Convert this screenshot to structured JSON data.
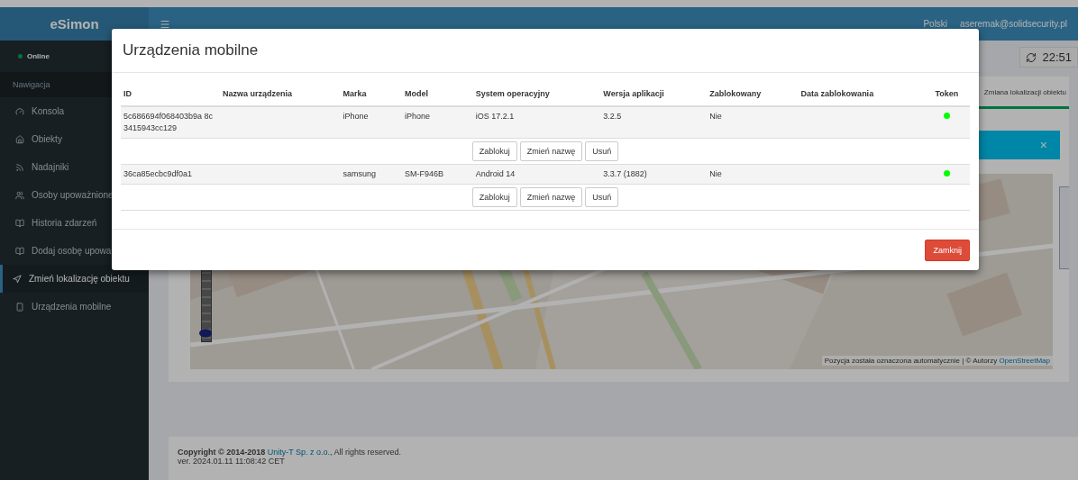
{
  "header": {
    "brand": "eSimon",
    "language": "Polski",
    "user": "aseremak@solidsecurity.pl"
  },
  "sidebar": {
    "status": "Online",
    "section": "Nawigacja",
    "items": [
      {
        "label": "Konsola",
        "selected": false
      },
      {
        "label": "Obiekty",
        "selected": false
      },
      {
        "label": "Nadajniki",
        "selected": false
      },
      {
        "label": "Osoby upoważnione",
        "selected": false
      },
      {
        "label": "Historia zdarzeń",
        "selected": false
      },
      {
        "label": "Dodaj osobę upowa",
        "selected": false
      },
      {
        "label": "Zmień lokalizację obiektu",
        "selected": true
      },
      {
        "label": "Urządzenia mobilne",
        "selected": false
      }
    ]
  },
  "content": {
    "time": "22:51",
    "tab": "Zmiana lokalizacji obiektu",
    "alert_close": "×",
    "map": {
      "kind": "picture",
      "zoom": {
        "level": 0.05
      },
      "attribution": "Pozycja została oznaczona automatycznie | © Autorzy ",
      "attribution_link": "OpenStreetMap"
    }
  },
  "footer": {
    "copyright": "**Copyright © 2014-2018** ",
    "company": "Unity-T Sp. z o.o.",
    "rights": ", All rights reserved.",
    "version": "ver. 2024.01.11 11:08:42 CET"
  },
  "modal": {
    "title": "Urządzenia mobilne",
    "columns": [
      "ID",
      "Nazwa urządzenia",
      "Marka",
      "Model",
      "System operacyjny",
      "Wersja aplikacji",
      "Zablokowany",
      "Data zablokowania",
      "Token"
    ],
    "rows": [
      {
        "id": "5c686694f068403b9a 8c3415943cc129",
        "name": "",
        "brand": "iPhone",
        "model": "iPhone",
        "os": "iOS 17.2.1",
        "version": "3.2.5",
        "blocked": "Nie",
        "blocked_date": "",
        "token": true,
        "actions": [
          "Zablokuj",
          "Zmień nazwę",
          "Usuń"
        ]
      },
      {
        "id": "36ca85ecbc9df0a1",
        "name": "",
        "brand": "samsung",
        "model": "SM-F946B",
        "os": "Android 14",
        "version": "3.3.7 (1882)",
        "blocked": "Nie",
        "blocked_date": "",
        "token": true,
        "actions": [
          "Zablokuj",
          "Zmień nazwę",
          "Usuń"
        ]
      }
    ],
    "close": "Zamknij"
  }
}
